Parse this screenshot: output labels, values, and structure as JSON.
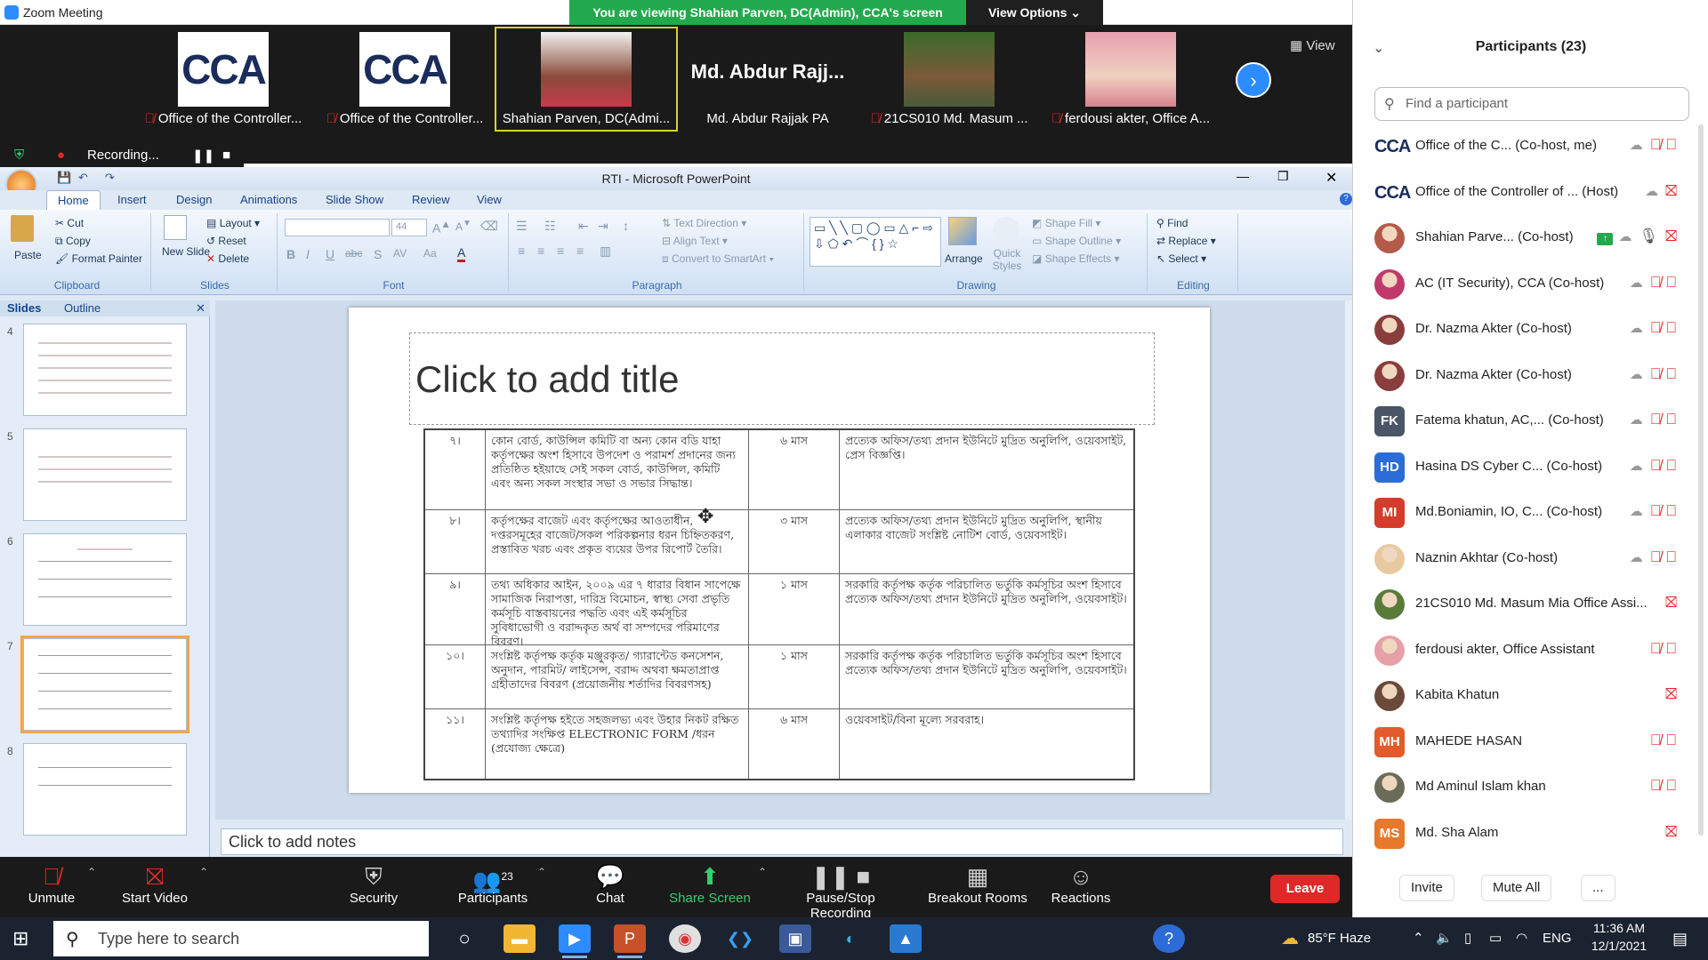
{
  "zoom": {
    "window_title": "Zoom Meeting",
    "banner": "You are viewing Shahian Parven, DC(Admin), CCA's screen",
    "view_options": "View Options",
    "view_label": "View",
    "recording_label": "Recording...",
    "tiles": [
      {
        "name": "Office of the Controller...",
        "muted": true
      },
      {
        "name": "Office of the Controller...",
        "muted": true
      },
      {
        "name": "Shahian Parven, DC(Admi...",
        "muted": false
      },
      {
        "name": "Md. Abdur Rajjak PA",
        "big_name": "Md. Abdur Rajj...",
        "muted": false
      },
      {
        "name": "21CS010 Md. Masum ...",
        "muted": true
      },
      {
        "name": "ferdousi akter, Office A...",
        "muted": true
      }
    ],
    "toolbar": {
      "unmute": "Unmute",
      "start_video": "Start Video",
      "security": "Security",
      "participants": "Participants",
      "participants_count": "23",
      "chat": "Chat",
      "share_screen": "Share Screen",
      "pause_stop_recording": "Pause/Stop Recording",
      "breakout_rooms": "Breakout Rooms",
      "reactions": "Reactions",
      "leave": "Leave"
    }
  },
  "ppt": {
    "title": "RTI  -  Microsoft PowerPoint",
    "tabs": [
      "Home",
      "Insert",
      "Design",
      "Animations",
      "Slide Show",
      "Review",
      "View"
    ],
    "clipboard": {
      "paste": "Paste",
      "cut": "Cut",
      "copy": "Copy",
      "format_painter": "Format Painter",
      "label": "Clipboard"
    },
    "slides_group": {
      "new_slide": "New Slide",
      "layout": "Layout",
      "reset": "Reset",
      "delete": "Delete",
      "label": "Slides"
    },
    "font_group": {
      "size": "44",
      "label": "Font"
    },
    "paragraph_group": {
      "text_direction": "Text Direction",
      "align_text": "Align Text",
      "convert_smartart": "Convert to SmartArt",
      "label": "Paragraph"
    },
    "drawing_group": {
      "arrange": "Arrange",
      "quick_styles": "Quick Styles",
      "shape_fill": "Shape Fill",
      "shape_outline": "Shape Outline",
      "shape_effects": "Shape Effects",
      "label": "Drawing"
    },
    "editing_group": {
      "find": "Find",
      "replace": "Replace",
      "select": "Select",
      "label": "Editing"
    },
    "pane_tabs": {
      "slides": "Slides",
      "outline": "Outline"
    },
    "thumb_numbers": [
      "4",
      "5",
      "6",
      "7",
      "8"
    ],
    "slide_title_placeholder": "Click to add title",
    "notes_placeholder": "Click to add notes",
    "table_rows": [
      {
        "num": "৭।",
        "desc": "কোন বোর্ড, কাউন্সিল কমিটি বা অন্য কোন বডি যাহা কর্তৃপক্ষের অংশ হিসাবে উপদেশ ও পরামর্শ প্রদানের জন্য প্রতিষ্ঠিত হইয়াছে সেই সকল বোর্ড, কাউন্সিল, কমিটি এবং অন্য সকল সংস্থার সভা ও সভার সিদ্ধান্ত।",
        "period": "৬ মাস",
        "method": "প্রত্যেক অফিস/তথ্য প্রদান ইউনিটে মুদ্রিত অনুলিপি, ওয়েবসাইট, প্রেস বিজ্ঞপ্তি।"
      },
      {
        "num": "৮।",
        "desc": "কর্তৃপক্ষের বাজেট এবং কর্তৃপক্ষের আওতাধীন, দপ্তরসমূহের বাজেট/সকল পরিকল্পনার ধরন চিহ্নিতকরণ, প্রস্তাবিত খরচ এবং প্রকৃত ব্যয়ের উপর রিপোর্ট তৈরি।",
        "period": "৩ মাস",
        "method": "প্রত্যেক অফিস/তথ্য প্রদান ইউনিটে মুদ্রিত অনুলিপি, স্থানীয় এলাকার বাজেট সংশ্লিষ্ট নোটিশ বোর্ড, ওয়েবসাইট।"
      },
      {
        "num": "৯।",
        "desc": "তথ্য অধিকার আইন, ২০০৯ এর ৭ ধারার বিধান সাপেক্ষে সামাজিক নিরাপত্তা, দারিদ্র বিমোচন, স্বাস্থ্য সেবা প্রভৃতি কর্মসূচি বাস্তবায়নের পদ্ধতি এবং এই কর্মসূচির সুবিধাভোগী ও বরাদ্দকৃত অর্থ বা সম্পদের পরিমাণের বিবরণ।",
        "period": "১ মাস",
        "method": "সরকারি কর্তৃপক্ষ কর্তৃক পরিচালিত ভর্তুকি কর্মসূচির অংশ হিসাবে প্রত্যেক অফিস/তথ্য প্রদান ইউনিটে মুদ্রিত অনুলিপি, ওয়েবসাইট।"
      },
      {
        "num": "১০।",
        "desc": "সংশ্লিষ্ট কর্তৃপক্ষ কর্তৃক মঞ্জুরকৃত/ গ্যারান্টেড কনসেশন, অনুদান, পারমিট/ লাইসেন্স, বরাদ্দ অথবা ক্ষমতাপ্রাপ্ত গ্রহীতাদের বিবরণ (প্রয়োজনীয় শর্তাদির বিবরণসহ)",
        "period": "১ মাস",
        "method": "সরকারি কর্তৃপক্ষ কর্তৃক পরিচালিত ভর্তুকি কর্মসূচির অংশ হিসাবে প্রত্যেক অফিস/তথ্য প্রদান ইউনিটে মুদ্রিত অনুলিপি, ওয়েবসাইট।"
      },
      {
        "num": "১১।",
        "desc": "সংশ্লিষ্ট কর্তৃপক্ষ হইতে সহজলভ্য এবং উহার নিকট রক্ষিত তথ্যাদির সংক্ষিপ্ত ELECTRONIC FORM /ধরন (প্রযোজ্য ক্ষেত্রে)",
        "period": "৬ মাস",
        "method": "ওয়েবসাইট/বিনা মূল্যে সরবরাহ।"
      }
    ]
  },
  "participants_panel": {
    "header": "Participants (23)",
    "search_placeholder": "Find a participant",
    "items": [
      {
        "avatar": "CCA",
        "avatar_type": "logo",
        "name": "Office of the C... (Co-host, me)",
        "icons": "cloud mic-off video-off"
      },
      {
        "avatar": "CCA",
        "avatar_type": "logo",
        "name": "Office of the Controller of ... (Host)",
        "icons": "cloud video-off"
      },
      {
        "avatar": "",
        "avatar_type": "photo",
        "color": "#b35a4a",
        "name": "Shahian Parve... (Co-host)",
        "icons": "share cloud mic-on video-off"
      },
      {
        "avatar": "",
        "avatar_type": "photo",
        "color": "#c0396b",
        "name": "AC (IT Security), CCA (Co-host)",
        "icons": "cloud mic-off video-off"
      },
      {
        "avatar": "",
        "avatar_type": "photo",
        "color": "#8a3d3d",
        "name": "Dr. Nazma Akter (Co-host)",
        "icons": "cloud mic-off video-off"
      },
      {
        "avatar": "",
        "avatar_type": "photo",
        "color": "#8a3d3d",
        "name": "Dr. Nazma Akter (Co-host)",
        "icons": "cloud mic-off video-off"
      },
      {
        "avatar": "FK",
        "avatar_type": "initials",
        "color": "#4a5568",
        "name": "Fatema khatun, AC,... (Co-host)",
        "icons": "cloud mic-off video-off"
      },
      {
        "avatar": "HD",
        "avatar_type": "initials",
        "color": "#2b6cd6",
        "name": "Hasina DS Cyber C... (Co-host)",
        "icons": "cloud mic-off video-off"
      },
      {
        "avatar": "MI",
        "avatar_type": "initials",
        "color": "#d63c2b",
        "name": "Md.Boniamin, IO, C... (Co-host)",
        "icons": "cloud mic-off video-off"
      },
      {
        "avatar": "",
        "avatar_type": "photo",
        "color": "#e8c9a0",
        "name": "Naznin Akhtar (Co-host)",
        "icons": "cloud mic-off video-off"
      },
      {
        "avatar": "",
        "avatar_type": "photo",
        "color": "#5a7a3a",
        "name": "21CS010 Md. Masum Mia Office Assi...",
        "icons": "video-off"
      },
      {
        "avatar": "",
        "avatar_type": "photo",
        "color": "#e6a0a8",
        "name": "ferdousi akter, Office Assistant",
        "icons": "mic-off video-off"
      },
      {
        "avatar": "",
        "avatar_type": "photo",
        "color": "#6b4a3a",
        "name": "Kabita Khatun",
        "icons": "video-off"
      },
      {
        "avatar": "MH",
        "avatar_type": "initials",
        "color": "#e35a2b",
        "name": "MAHEDE HASAN",
        "icons": "mic-off video-off"
      },
      {
        "avatar": "",
        "avatar_type": "photo",
        "color": "#6b6b5a",
        "name": "Md Aminul Islam khan",
        "icons": "mic-off video-off"
      },
      {
        "avatar": "MS",
        "avatar_type": "initials",
        "color": "#e8782b",
        "name": "Md. Sha Alam",
        "icons": "video-off"
      }
    ],
    "invite": "Invite",
    "mute_all": "Mute All",
    "more": "..."
  },
  "taskbar": {
    "search_placeholder": "Type here to search",
    "weather": "85°F  Haze",
    "language": "ENG",
    "time": "11:36 AM",
    "date": "12/1/2021"
  }
}
